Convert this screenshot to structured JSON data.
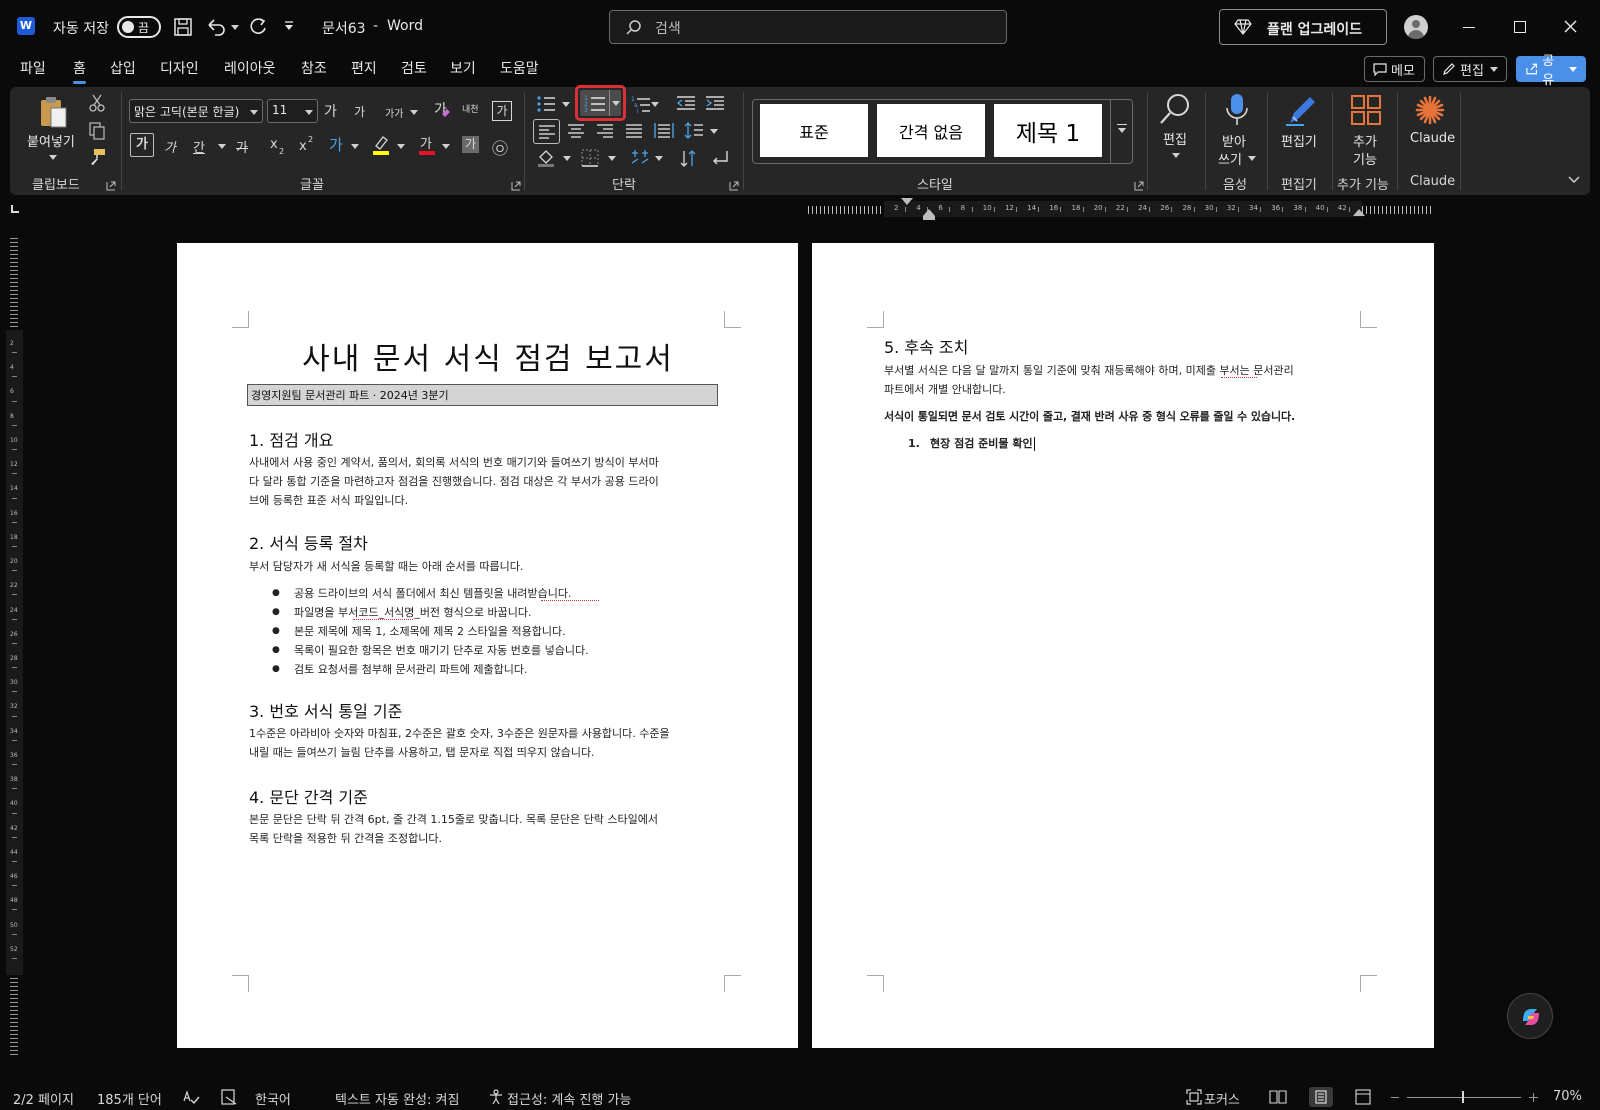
{
  "titlebar": {
    "autosave_label": "자동 저장",
    "autosave_state": "끔",
    "doc_name": "문서63",
    "separator": "-",
    "app_name": "Word",
    "search_placeholder": "검색",
    "upgrade_label": "플랜 업그레이드"
  },
  "tabs": [
    "파일",
    "홈",
    "삽입",
    "디자인",
    "레이아웃",
    "참조",
    "편지",
    "검토",
    "보기",
    "도움말"
  ],
  "active_tab": "홈",
  "top_buttons": {
    "memo": "메모",
    "edit": "편집",
    "share": "공유"
  },
  "ribbon": {
    "clipboard": {
      "paste_label": "붙여넣기",
      "group_label": "클립보드"
    },
    "font": {
      "font_name": "맑은 고딕(본문 한글)",
      "font_size": "11",
      "grow": "가",
      "shrink": "가",
      "case": "가가",
      "phonetic": "내천",
      "enclose": "가",
      "bold": "가",
      "italic": "가",
      "underline": "간",
      "strike": "가",
      "subscript": "x",
      "superscript": "x",
      "highlight_color": "#ffff00",
      "font_color": "#e81123",
      "char_shade": "가",
      "enclosed_char": "㉧",
      "group_label": "글꼴"
    },
    "paragraph": {
      "group_label": "단락"
    },
    "styles": {
      "items": [
        "표준",
        "간격 없음",
        "제목 1"
      ],
      "group_label": "스타일"
    },
    "editing": {
      "label": "편집",
      "group_label": ""
    },
    "voice": {
      "label_line1": "받아",
      "label_line2": "쓰기",
      "group_label": "음성"
    },
    "editor": {
      "label": "편집기",
      "group_label": "편집기"
    },
    "addins": {
      "label_line1": "추가",
      "label_line2": "기능",
      "group_label": "추가 기능"
    },
    "claude": {
      "label": "Claude",
      "group_label": "Claude"
    }
  },
  "ruler": {
    "ticks": [
      "2",
      "4",
      "6",
      "8",
      "10",
      "12",
      "14",
      "16",
      "18",
      "20",
      "22",
      "24",
      "26",
      "28",
      "30",
      "32",
      "34",
      "36",
      "38",
      "40",
      "42"
    ]
  },
  "vruler": {
    "ticks": [
      "2",
      "4",
      "6",
      "8",
      "10",
      "12",
      "14",
      "16",
      "18",
      "20",
      "22",
      "24",
      "26",
      "28",
      "30",
      "32",
      "34",
      "36",
      "38",
      "40",
      "42",
      "44",
      "46",
      "48",
      "50",
      "52"
    ]
  },
  "page1": {
    "title": "사내 문서 서식 점검 보고서",
    "subtitle": "경영지원팀 문서관리 파트 · 2024년 3분기",
    "s1_heading": "1. 점검 개요",
    "s1_line1": "사내에서 사용 중인 계약서, 품의서, 회의록 서식의 번호 매기기와 들여쓰기 방식이 부서마",
    "s1_line2": "다 달라 통합 기준을 마련하고자 점검을 진행했습니다. 점검 대상은 각 부서가 공용 드라이",
    "s1_line3": "브에 등록한 표준 서식 파일입니다.",
    "s2_heading": "2. 서식 등록 절차",
    "s2_intro": "부서 담당자가 새 서식을 등록할 때는 아래 순서를 따릅니다.",
    "s2_bullets": [
      "공용 드라이브의 서식 폴더에서 최신 템플릿을 내려받습니다.",
      "파일명을 부서코드_서식명_버전 형식으로 바꿉니다.",
      "본문 제목에 제목 1, 소제목에 제목 2 스타일을 적용합니다.",
      "목록이 필요한 항목은 번호 매기기 단추로 자동 번호를 넣습니다.",
      "검토 요청서를 첨부해 문서관리 파트에 제출합니다."
    ],
    "s3_heading": "3. 번호 서식 통일 기준",
    "s3_line1": "1수준은 아라비아 숫자와 마침표, 2수준은 괄호 숫자, 3수준은 원문자를 사용합니다. 수준을",
    "s3_line2": "내릴 때는 들여쓰기 늘림 단추를 사용하고, 탭 문자로 직접 띄우지 않습니다.",
    "s4_heading": "4. 문단 간격 기준",
    "s4_line1": "본문 문단은 단락 뒤 간격 6pt, 줄 간격 1.15줄로 맞춥니다. 목록 문단은 단락 스타일에서",
    "s4_line2": "목록 단락을 적용한 뒤 간격을 조정합니다."
  },
  "page2": {
    "s5_heading": "5. 후속 조치",
    "s5_line1": "부서별 서식은 다음 달 말까지 통일 기준에 맞춰 재등록해야 하며, 미제출 부서는 문서관리",
    "s5_line2": "파트에서 개별 안내합니다.",
    "bold_line": "서식이 통일되면 문서 검토 시간이 줄고, 결재 반려 사유 중 형식 오류를 줄일 수 있습니다.",
    "list_number": "1.",
    "list_item": "현장 점검 준비물 확인"
  },
  "status": {
    "page": "2/2 페이지",
    "words": "185개 단어",
    "language": "한국어",
    "autocomplete": "텍스트 자동 완성: 켜짐",
    "accessibility": "접근성: 계속 진행 가능",
    "focus": "포커스",
    "zoom": "70%"
  },
  "colors": {
    "accent": "#4a8fe8",
    "highlight_box": "#d9303a",
    "share_bg": "#4a8fe8",
    "claude_orange": "#e8743b"
  }
}
